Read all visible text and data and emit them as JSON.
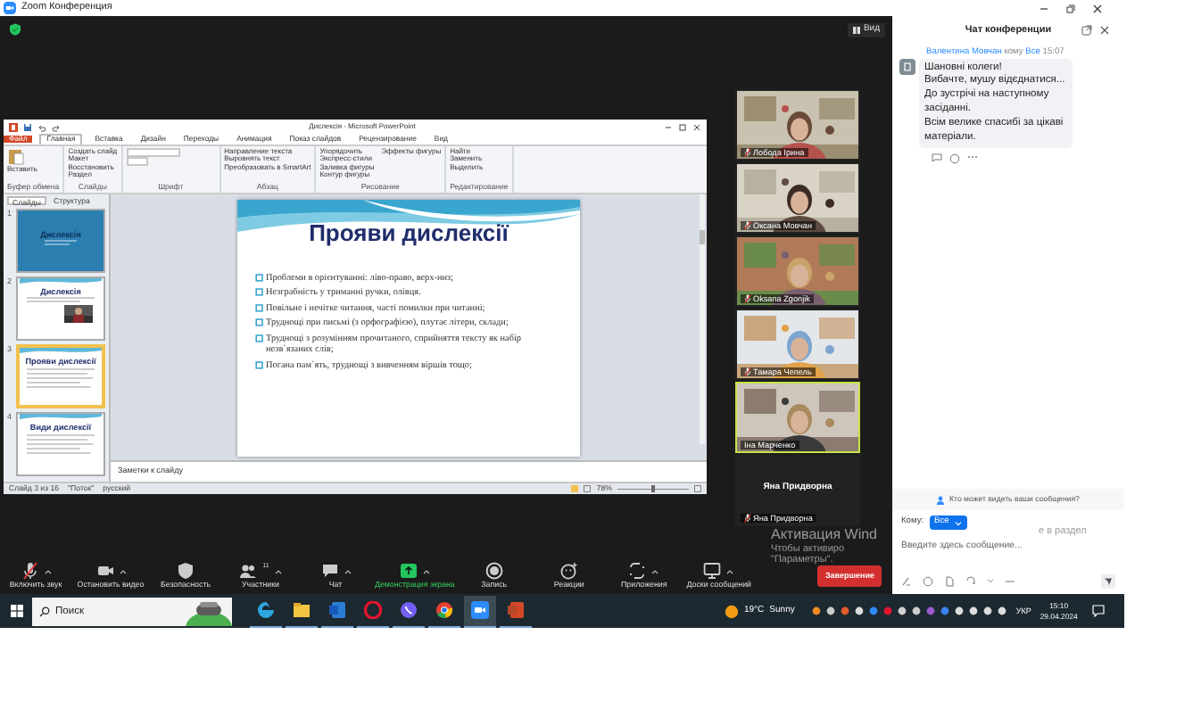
{
  "window": {
    "title": "Zoom Конференция"
  },
  "view_button": "Вид",
  "presentation": {
    "title": "Дислексія - Microsoft PowerPoint",
    "tabs": [
      {
        "label": "Файл",
        "kind": "file",
        "selected": false
      },
      {
        "label": "Главная",
        "kind": "tab",
        "selected": true
      },
      {
        "label": "Вставка",
        "kind": "tab",
        "selected": false
      },
      {
        "label": "Дизайн",
        "kind": "tab",
        "selected": false
      },
      {
        "label": "Переходы",
        "kind": "tab",
        "selected": false
      },
      {
        "label": "Анимация",
        "kind": "tab",
        "selected": false
      },
      {
        "label": "Показ слайдов",
        "kind": "tab",
        "selected": false
      },
      {
        "label": "Рецензирование",
        "kind": "tab",
        "selected": false
      },
      {
        "label": "Вид",
        "kind": "tab",
        "selected": false
      }
    ],
    "ribbon_groups": [
      {
        "label": "Буфер обмена",
        "buttons": [
          "Вставить"
        ]
      },
      {
        "label": "Слайды",
        "buttons": [
          "Создать слайд",
          "Макет",
          "Восстановить",
          "Раздел"
        ]
      },
      {
        "label": "Шрифт"
      },
      {
        "label": "Абзац",
        "buttons": [
          "Направление текста",
          "Выровнять текст",
          "Преобразовать в SmartArt"
        ]
      },
      {
        "label": "Рисование",
        "buttons": [
          "Упорядочить",
          "Экспресс-стили",
          "Заливка фигуры",
          "Контур фигуры",
          "Эффекты фигуры"
        ]
      },
      {
        "label": "Редактирование",
        "buttons": [
          "Найти",
          "Заменить",
          "Выделить"
        ]
      }
    ],
    "pane_tabs": [
      {
        "label": "Слайды",
        "selected": true
      },
      {
        "label": "Структура",
        "selected": false
      }
    ],
    "thumbnails": [
      {
        "number": "1",
        "title": "Дислексія",
        "kind": "title",
        "selected": false
      },
      {
        "number": "2",
        "title": "Дислексія",
        "selected": false
      },
      {
        "number": "3",
        "title": "Прояви дислексії",
        "kind": "text",
        "selected": true
      },
      {
        "number": "4",
        "title": "Види дислексії",
        "kind": "text",
        "selected": false
      }
    ],
    "slide": {
      "title": "Прояви дислексії",
      "bullets": [
        "Проблеми в орієнтуванні: ліво-право, верх-низ;",
        "Незграбність у триманні ручки, олівця.",
        "Повільне і нечітке читання, часті помилки при читанні;",
        "Труднощі при письмі (з орфографією), плутає літери, склади;",
        "Труднощі з розумінням прочитаного, сприйняття тексту як набір незв`язаних слів;",
        "Погана пам`ять, труднощі з вивченням віршів тощо;"
      ]
    },
    "notes_placeholder": "Заметки к слайду",
    "status": [
      "Слайд 3 из 16",
      "\"Поток\"",
      "русский"
    ],
    "zoom": "78%",
    "zoom_slider": {
      "level": 0.5
    }
  },
  "participants": [
    {
      "name": "Лобода Ірина",
      "kind": "video",
      "muted": true,
      "selected": false
    },
    {
      "name": "Оксана Мовчан",
      "kind": "video",
      "muted": true,
      "selected": false
    },
    {
      "name": "Oksana Zgonjik",
      "kind": "video",
      "muted": true,
      "selected": false
    },
    {
      "name": "Тамара Чепель",
      "kind": "video",
      "muted": true,
      "selected": false
    },
    {
      "name": "Іна Марченко",
      "kind": "video",
      "muted": false,
      "selected": true
    },
    {
      "name": "Яна Придворна",
      "display_name": "Яна Придворна",
      "kind": "name",
      "muted": true,
      "selected": false
    }
  ],
  "toolbar": [
    {
      "label": "Включить звук",
      "kind": "mic-off",
      "caret": true,
      "active": false
    },
    {
      "label": "Остановить видео",
      "kind": "video",
      "caret": true,
      "active": false
    },
    {
      "label": "Безопасность",
      "kind": "shield",
      "caret": false,
      "active": false
    },
    {
      "label": "Участники",
      "kind": "people",
      "count": "11",
      "caret": true,
      "active": false
    },
    {
      "label": "Чат",
      "kind": "chat",
      "caret": true,
      "active": false
    },
    {
      "label": "Демонстрация экрана",
      "kind": "share",
      "caret": true,
      "active": true
    },
    {
      "label": "Запись",
      "kind": "record",
      "caret": false,
      "active": false
    },
    {
      "label": "Реакции",
      "kind": "reaction",
      "caret": false,
      "active": false
    },
    {
      "label": "Приложения",
      "kind": "apps",
      "caret": true,
      "active": false
    },
    {
      "label": "Доски сообщений",
      "kind": "board",
      "caret": true,
      "active": false
    }
  ],
  "end_button": "Завершение",
  "activation_notice": {
    "title": "Активация Wind",
    "lines": [
      "Чтобы активиро",
      "\"Параметры\"."
    ],
    "covered_tail": "е в раздел"
  },
  "chat": {
    "title": "Чат конференции",
    "messages": [
      {
        "sender": "Валентина Мовчан",
        "to_label": "кому",
        "recipient": "Все",
        "time": "15:07",
        "lines": [
          "Шановні колеги!",
          "Вибачте, мушу відєднатися...",
          "До зустрічі на наступному засіданні.",
          "Всім велике спасибі за цікаві матеріали."
        ]
      }
    ],
    "visibility_hint": "Кто может видеть ваши сообщения?",
    "to_label": "Кому:",
    "recipient_button": "Все",
    "placeholder": "Введите здесь сообщение..."
  },
  "taskbar": {
    "search_placeholder": "Поиск",
    "apps": [
      {
        "kind": "edge",
        "selected": false
      },
      {
        "kind": "explorer",
        "selected": false
      },
      {
        "kind": "word",
        "selected": false
      },
      {
        "kind": "opera",
        "selected": false
      },
      {
        "kind": "viber",
        "selected": false
      },
      {
        "kind": "chrome",
        "selected": false
      },
      {
        "kind": "zoom",
        "selected": true
      },
      {
        "kind": "powerpoint",
        "selected": false
      }
    ],
    "weather": {
      "temperature": "19°C",
      "condition": "Sunny"
    },
    "language": "УКР",
    "time": "15:10",
    "date": "29.04.2024"
  }
}
